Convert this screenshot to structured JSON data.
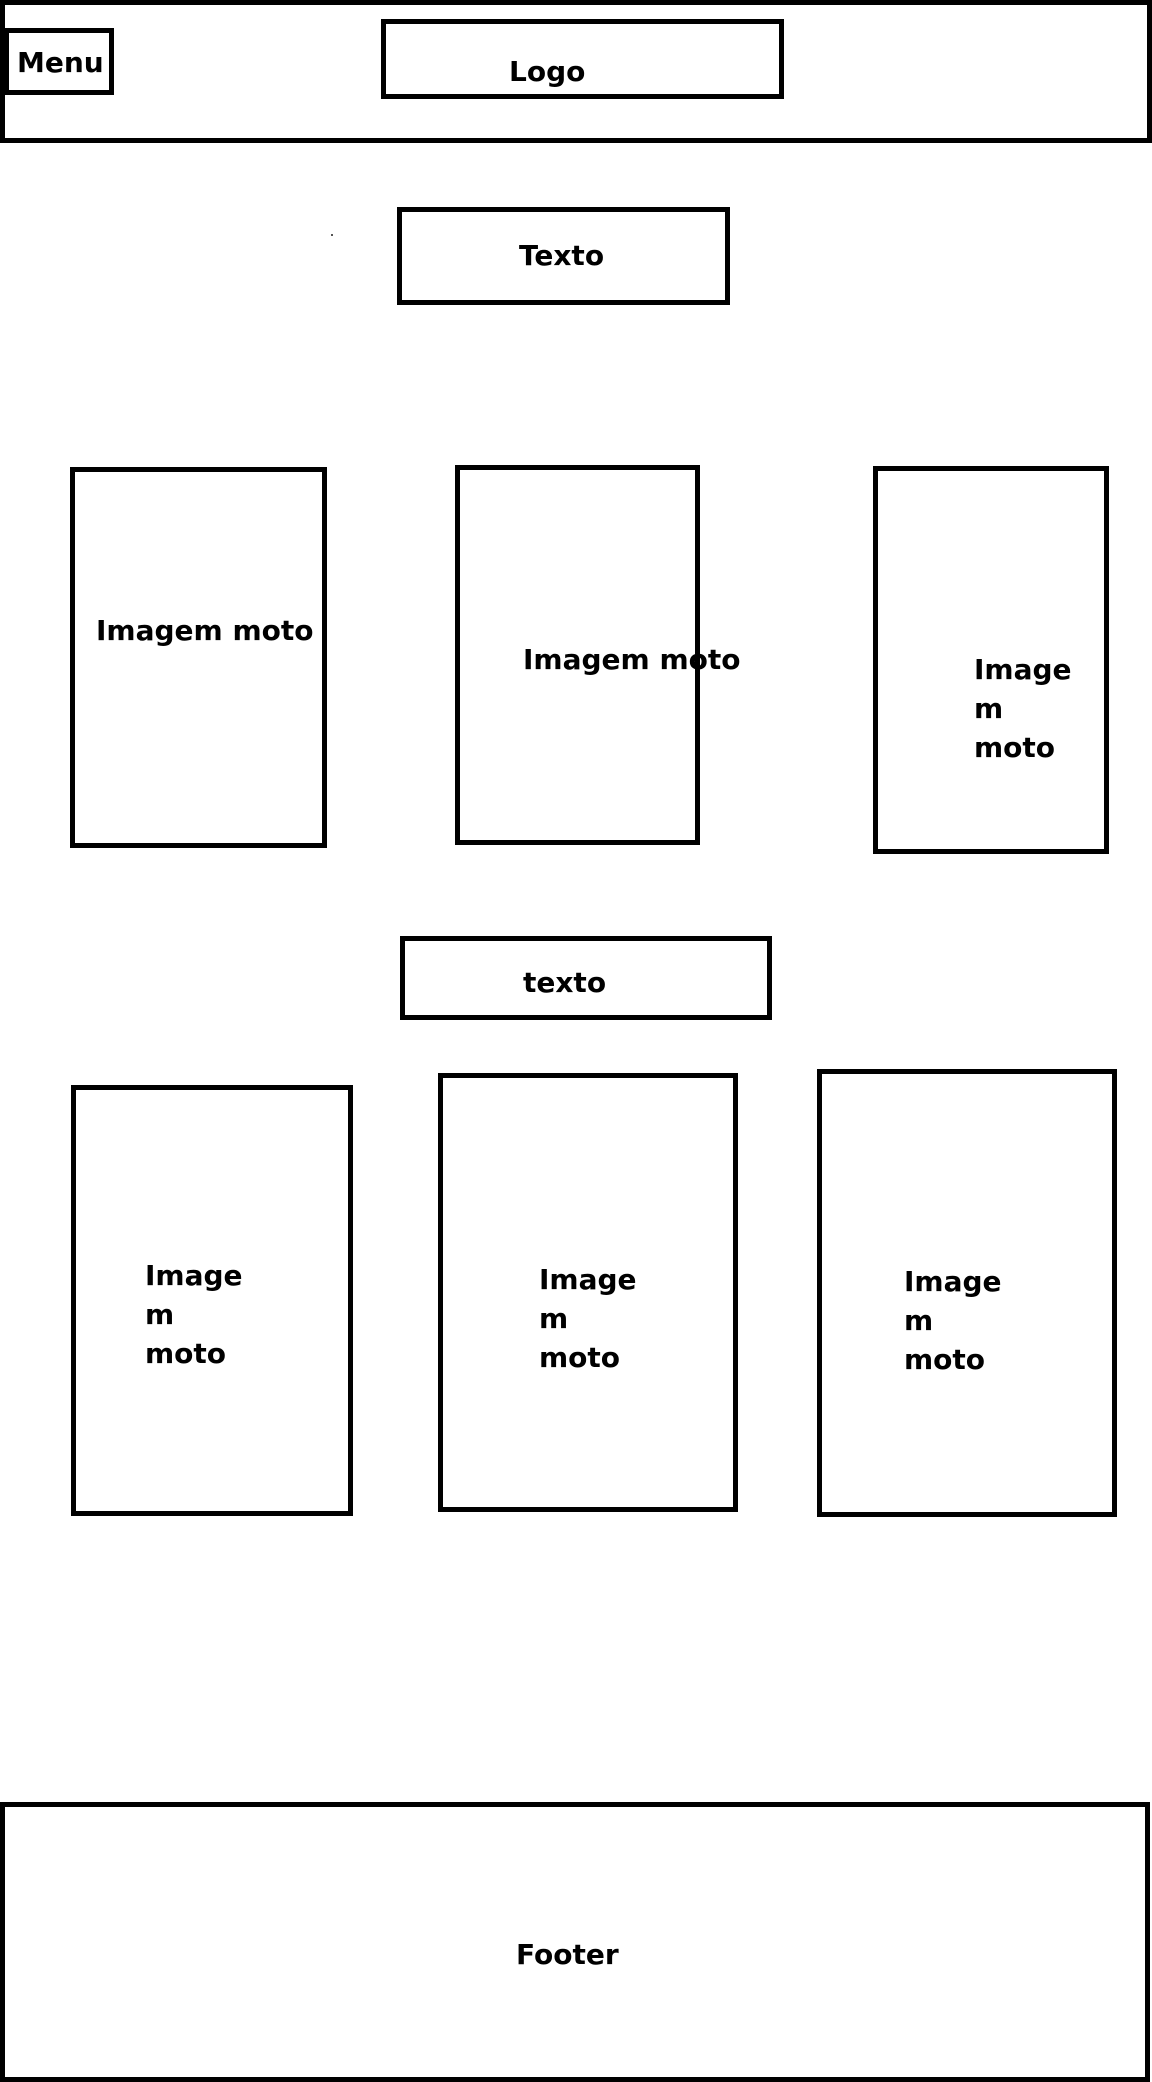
{
  "header": {
    "menu_label": "Menu",
    "logo_label": "Logo"
  },
  "section_1": {
    "text_label": "Texto",
    "cards": [
      {
        "lines": [
          "Imagem moto"
        ]
      },
      {
        "lines": [
          "Imagem moto"
        ]
      },
      {
        "lines": [
          "Image",
          "m",
          "moto"
        ]
      }
    ]
  },
  "section_2": {
    "text_label": "texto",
    "cards": [
      {
        "lines": [
          "Image",
          "m",
          "moto"
        ]
      },
      {
        "lines": [
          "Image",
          "m",
          "moto"
        ]
      },
      {
        "lines": [
          "Image",
          "m",
          "moto"
        ]
      }
    ]
  },
  "footer": {
    "label": "Footer"
  }
}
